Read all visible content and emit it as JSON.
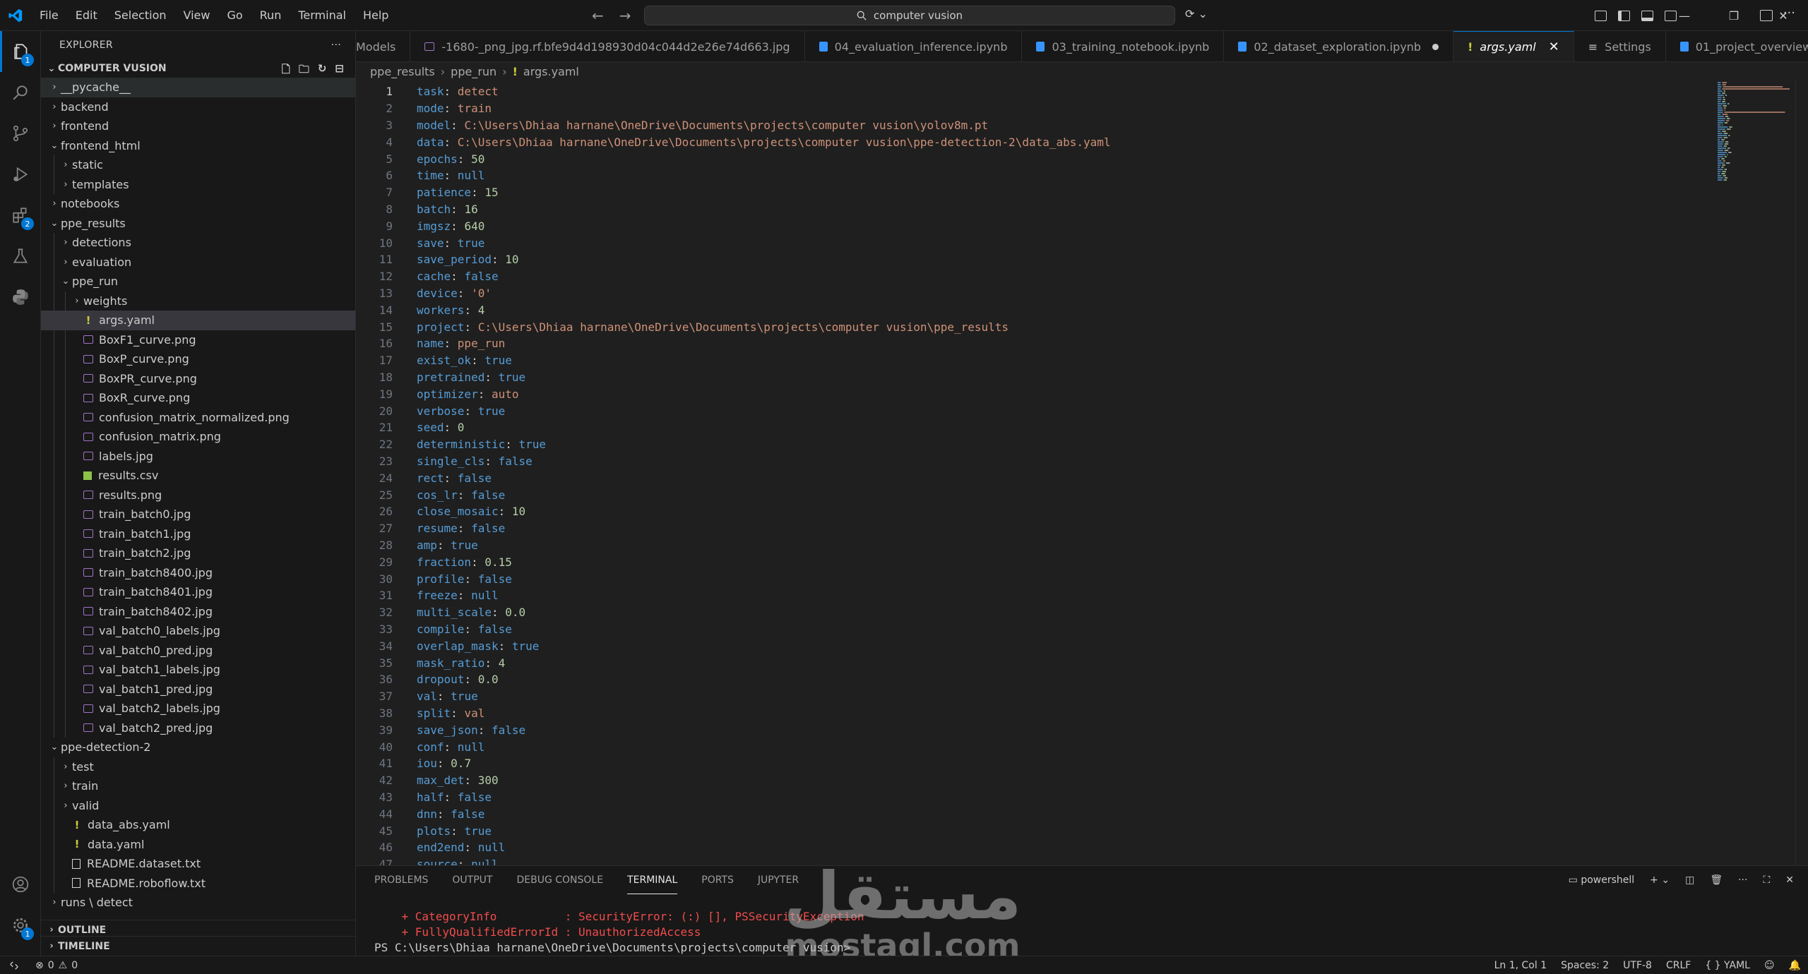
{
  "menu": [
    "File",
    "Edit",
    "Selection",
    "View",
    "Go",
    "Run",
    "Terminal",
    "Help"
  ],
  "search": {
    "text": "computer vusion"
  },
  "colors": {
    "accent": "#0078d4",
    "bg": "#1f1f1f",
    "sidebar_bg": "#181818",
    "key": "#569cd6",
    "string": "#ce9178",
    "number": "#b5cea8",
    "error": "#f14c4c"
  },
  "activity_badges": {
    "explorer": "1",
    "extensions": "2",
    "accounts": "1"
  },
  "explorer": {
    "title": "EXPLORER",
    "folder": "COMPUTER VUSION",
    "tree": [
      {
        "label": "__pycache__",
        "depth": 0,
        "type": "folder",
        "open": false
      },
      {
        "label": "backend",
        "depth": 0,
        "type": "folder",
        "open": false
      },
      {
        "label": "frontend",
        "depth": 0,
        "type": "folder",
        "open": false
      },
      {
        "label": "frontend_html",
        "depth": 0,
        "type": "folder",
        "open": true
      },
      {
        "label": "static",
        "depth": 1,
        "type": "folder",
        "open": false
      },
      {
        "label": "templates",
        "depth": 1,
        "type": "folder",
        "open": false
      },
      {
        "label": "notebooks",
        "depth": 0,
        "type": "folder",
        "open": false
      },
      {
        "label": "ppe_results",
        "depth": 0,
        "type": "folder",
        "open": true
      },
      {
        "label": "detections",
        "depth": 1,
        "type": "folder",
        "open": false
      },
      {
        "label": "evaluation",
        "depth": 1,
        "type": "folder",
        "open": false
      },
      {
        "label": "ppe_run",
        "depth": 1,
        "type": "folder",
        "open": true
      },
      {
        "label": "weights",
        "depth": 2,
        "type": "folder",
        "open": false
      },
      {
        "label": "args.yaml",
        "depth": 2,
        "type": "yaml",
        "selected": true
      },
      {
        "label": "BoxF1_curve.png",
        "depth": 2,
        "type": "img"
      },
      {
        "label": "BoxP_curve.png",
        "depth": 2,
        "type": "img"
      },
      {
        "label": "BoxPR_curve.png",
        "depth": 2,
        "type": "img"
      },
      {
        "label": "BoxR_curve.png",
        "depth": 2,
        "type": "img"
      },
      {
        "label": "confusion_matrix_normalized.png",
        "depth": 2,
        "type": "img"
      },
      {
        "label": "confusion_matrix.png",
        "depth": 2,
        "type": "img"
      },
      {
        "label": "labels.jpg",
        "depth": 2,
        "type": "img"
      },
      {
        "label": "results.csv",
        "depth": 2,
        "type": "csv"
      },
      {
        "label": "results.png",
        "depth": 2,
        "type": "img"
      },
      {
        "label": "train_batch0.jpg",
        "depth": 2,
        "type": "img"
      },
      {
        "label": "train_batch1.jpg",
        "depth": 2,
        "type": "img"
      },
      {
        "label": "train_batch2.jpg",
        "depth": 2,
        "type": "img"
      },
      {
        "label": "train_batch8400.jpg",
        "depth": 2,
        "type": "img"
      },
      {
        "label": "train_batch8401.jpg",
        "depth": 2,
        "type": "img"
      },
      {
        "label": "train_batch8402.jpg",
        "depth": 2,
        "type": "img"
      },
      {
        "label": "val_batch0_labels.jpg",
        "depth": 2,
        "type": "img"
      },
      {
        "label": "val_batch0_pred.jpg",
        "depth": 2,
        "type": "img"
      },
      {
        "label": "val_batch1_labels.jpg",
        "depth": 2,
        "type": "img"
      },
      {
        "label": "val_batch1_pred.jpg",
        "depth": 2,
        "type": "img"
      },
      {
        "label": "val_batch2_labels.jpg",
        "depth": 2,
        "type": "img"
      },
      {
        "label": "val_batch2_pred.jpg",
        "depth": 2,
        "type": "img"
      },
      {
        "label": "ppe-detection-2",
        "depth": 0,
        "type": "folder",
        "open": true
      },
      {
        "label": "test",
        "depth": 1,
        "type": "folder",
        "open": false
      },
      {
        "label": "train",
        "depth": 1,
        "type": "folder",
        "open": false
      },
      {
        "label": "valid",
        "depth": 1,
        "type": "folder",
        "open": false
      },
      {
        "label": "data_abs.yaml",
        "depth": 1,
        "type": "yaml"
      },
      {
        "label": "data.yaml",
        "depth": 1,
        "type": "yaml"
      },
      {
        "label": "README.dataset.txt",
        "depth": 1,
        "type": "txt"
      },
      {
        "label": "README.roboflow.txt",
        "depth": 1,
        "type": "txt"
      },
      {
        "label": "runs \\ detect",
        "depth": 0,
        "type": "folder",
        "open": false
      }
    ],
    "outline": "OUTLINE",
    "timeline": "TIMELINE"
  },
  "tabs": [
    {
      "label": "Models",
      "icon": "none",
      "active": false
    },
    {
      "label": "-1680-_png_jpg.rf.bfe9d4d198930d04c044d2e26e74d663.jpg",
      "icon": "img",
      "active": false
    },
    {
      "label": "04_evaluation_inference.ipynb",
      "icon": "nb",
      "active": false
    },
    {
      "label": "03_training_notebook.ipynb",
      "icon": "nb",
      "active": false
    },
    {
      "label": "02_dataset_exploration.ipynb",
      "icon": "nb",
      "active": false,
      "dirty": true
    },
    {
      "label": "args.yaml",
      "icon": "yaml",
      "active": true
    },
    {
      "label": "Settings",
      "icon": "gear",
      "active": false
    },
    {
      "label": "01_project_overview.ipynb",
      "icon": "nb",
      "active": false
    }
  ],
  "breadcrumb": [
    "ppe_results",
    "ppe_run",
    "args.yaml"
  ],
  "code": [
    {
      "k": "task",
      "v": "detect",
      "t": "str"
    },
    {
      "k": "mode",
      "v": "train",
      "t": "str"
    },
    {
      "k": "model",
      "v": "C:\\Users\\Dhiaa harnane\\OneDrive\\Documents\\projects\\computer vusion\\yolov8m.pt",
      "t": "str"
    },
    {
      "k": "data",
      "v": "C:\\Users\\Dhiaa harnane\\OneDrive\\Documents\\projects\\computer vusion\\ppe-detection-2\\data_abs.yaml",
      "t": "str"
    },
    {
      "k": "epochs",
      "v": "50",
      "t": "num"
    },
    {
      "k": "time",
      "v": "null",
      "t": "kw"
    },
    {
      "k": "patience",
      "v": "15",
      "t": "num"
    },
    {
      "k": "batch",
      "v": "16",
      "t": "num"
    },
    {
      "k": "imgsz",
      "v": "640",
      "t": "num"
    },
    {
      "k": "save",
      "v": "true",
      "t": "kw"
    },
    {
      "k": "save_period",
      "v": "10",
      "t": "num"
    },
    {
      "k": "cache",
      "v": "false",
      "t": "kw"
    },
    {
      "k": "device",
      "v": "'0'",
      "t": "str"
    },
    {
      "k": "workers",
      "v": "4",
      "t": "num"
    },
    {
      "k": "project",
      "v": "C:\\Users\\Dhiaa harnane\\OneDrive\\Documents\\projects\\computer vusion\\ppe_results",
      "t": "str"
    },
    {
      "k": "name",
      "v": "ppe_run",
      "t": "str"
    },
    {
      "k": "exist_ok",
      "v": "true",
      "t": "kw"
    },
    {
      "k": "pretrained",
      "v": "true",
      "t": "kw"
    },
    {
      "k": "optimizer",
      "v": "auto",
      "t": "str"
    },
    {
      "k": "verbose",
      "v": "true",
      "t": "kw"
    },
    {
      "k": "seed",
      "v": "0",
      "t": "num"
    },
    {
      "k": "deterministic",
      "v": "true",
      "t": "kw"
    },
    {
      "k": "single_cls",
      "v": "false",
      "t": "kw"
    },
    {
      "k": "rect",
      "v": "false",
      "t": "kw"
    },
    {
      "k": "cos_lr",
      "v": "false",
      "t": "kw"
    },
    {
      "k": "close_mosaic",
      "v": "10",
      "t": "num"
    },
    {
      "k": "resume",
      "v": "false",
      "t": "kw"
    },
    {
      "k": "amp",
      "v": "true",
      "t": "kw"
    },
    {
      "k": "fraction",
      "v": "0.15",
      "t": "num"
    },
    {
      "k": "profile",
      "v": "false",
      "t": "kw"
    },
    {
      "k": "freeze",
      "v": "null",
      "t": "kw"
    },
    {
      "k": "multi_scale",
      "v": "0.0",
      "t": "num"
    },
    {
      "k": "compile",
      "v": "false",
      "t": "kw"
    },
    {
      "k": "overlap_mask",
      "v": "true",
      "t": "kw"
    },
    {
      "k": "mask_ratio",
      "v": "4",
      "t": "num"
    },
    {
      "k": "dropout",
      "v": "0.0",
      "t": "num"
    },
    {
      "k": "val",
      "v": "true",
      "t": "kw"
    },
    {
      "k": "split",
      "v": "val",
      "t": "str"
    },
    {
      "k": "save_json",
      "v": "false",
      "t": "kw"
    },
    {
      "k": "conf",
      "v": "null",
      "t": "kw"
    },
    {
      "k": "iou",
      "v": "0.7",
      "t": "num"
    },
    {
      "k": "max_det",
      "v": "300",
      "t": "num"
    },
    {
      "k": "half",
      "v": "false",
      "t": "kw"
    },
    {
      "k": "dnn",
      "v": "false",
      "t": "kw"
    },
    {
      "k": "plots",
      "v": "true",
      "t": "kw"
    },
    {
      "k": "end2end",
      "v": "null",
      "t": "kw"
    },
    {
      "k": "source",
      "v": "null",
      "t": "kw"
    }
  ],
  "panel": {
    "tabs": [
      "PROBLEMS",
      "OUTPUT",
      "DEBUG CONSOLE",
      "TERMINAL",
      "PORTS",
      "JUPYTER"
    ],
    "active_tab": "TERMINAL",
    "shell": "powershell",
    "lines": [
      "    + CategoryInfo          : SecurityError: (:) [], PSSecurityException",
      "    + FullyQualifiedErrorId : UnauthorizedAccess"
    ],
    "prompt": "PS C:\\Users\\Dhiaa harnane\\OneDrive\\Documents\\projects\\computer vusion>"
  },
  "watermark": {
    "arabic": "مستقل",
    "latin": "mostaql.com"
  },
  "status": {
    "errors": "0",
    "warnings": "0",
    "cursor": "Ln 1, Col 1",
    "spaces": "Spaces: 2",
    "encoding": "UTF-8",
    "eol": "CRLF",
    "language": "YAML"
  }
}
